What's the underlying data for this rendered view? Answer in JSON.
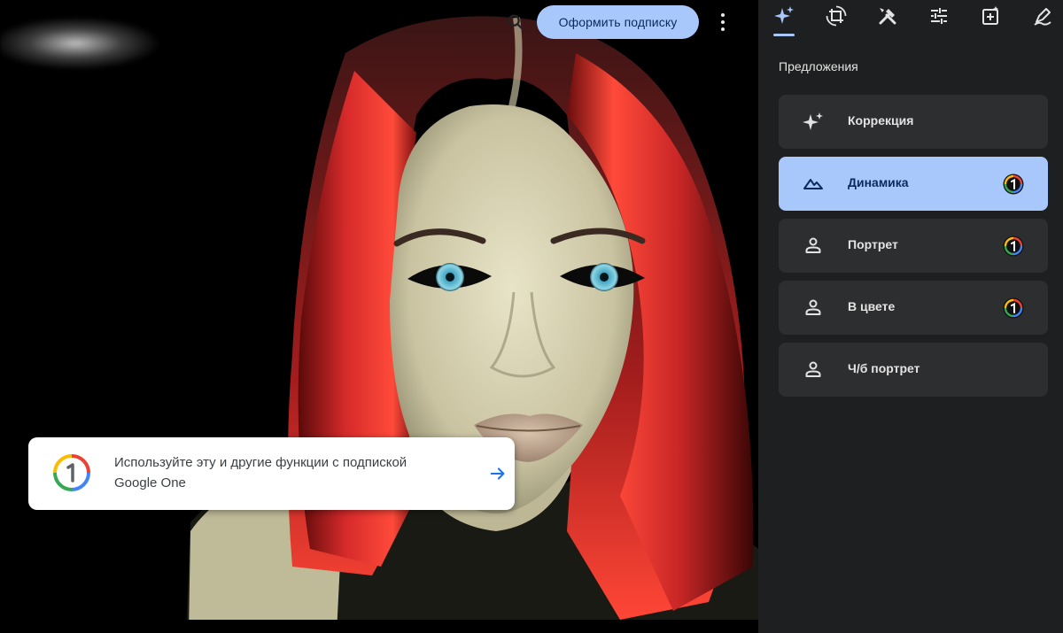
{
  "header": {
    "subscribe_label": "Оформить подписку",
    "zoom_icon": "zoom-icon",
    "more_icon": "more-vert-icon"
  },
  "promo": {
    "text_line1": "Используйте эту и другие функции с подпиской",
    "text_line2": "Google One",
    "logo_icon": "google-one-icon",
    "arrow_icon": "arrow-right-icon"
  },
  "toolbar": {
    "tools": [
      {
        "name": "suggestions-tool",
        "icon": "sparkle-icon",
        "active": true
      },
      {
        "name": "crop-rotate-tool",
        "icon": "crop-rotate-icon",
        "active": false
      },
      {
        "name": "tools-tool",
        "icon": "tools-icon",
        "active": false
      },
      {
        "name": "adjust-tool",
        "icon": "sliders-icon",
        "active": false
      },
      {
        "name": "filters-tool",
        "icon": "filter-plus-icon",
        "active": false
      },
      {
        "name": "markup-tool",
        "icon": "markup-icon",
        "active": false
      }
    ]
  },
  "panel": {
    "section_title": "Предложения",
    "suggestions": [
      {
        "label": "Коррекция",
        "icon": "sparkle-icon",
        "premium": false,
        "active": false
      },
      {
        "label": "Динамика",
        "icon": "landscape-icon",
        "premium": true,
        "active": true
      },
      {
        "label": "Портрет",
        "icon": "person-icon",
        "premium": true,
        "active": false
      },
      {
        "label": "В цвете",
        "icon": "person-icon",
        "premium": true,
        "active": false
      },
      {
        "label": "Ч/б портрет",
        "icon": "person-icon",
        "premium": false,
        "active": false
      }
    ]
  },
  "colors": {
    "accent": "#a8c7fa",
    "panel_bg": "#1e1f20",
    "card_bg": "#2d2e30",
    "text": "#e3e3e3",
    "google_blue": "#4285f4",
    "google_red": "#ea4335",
    "google_yellow": "#fbbc04",
    "google_green": "#34a853"
  }
}
